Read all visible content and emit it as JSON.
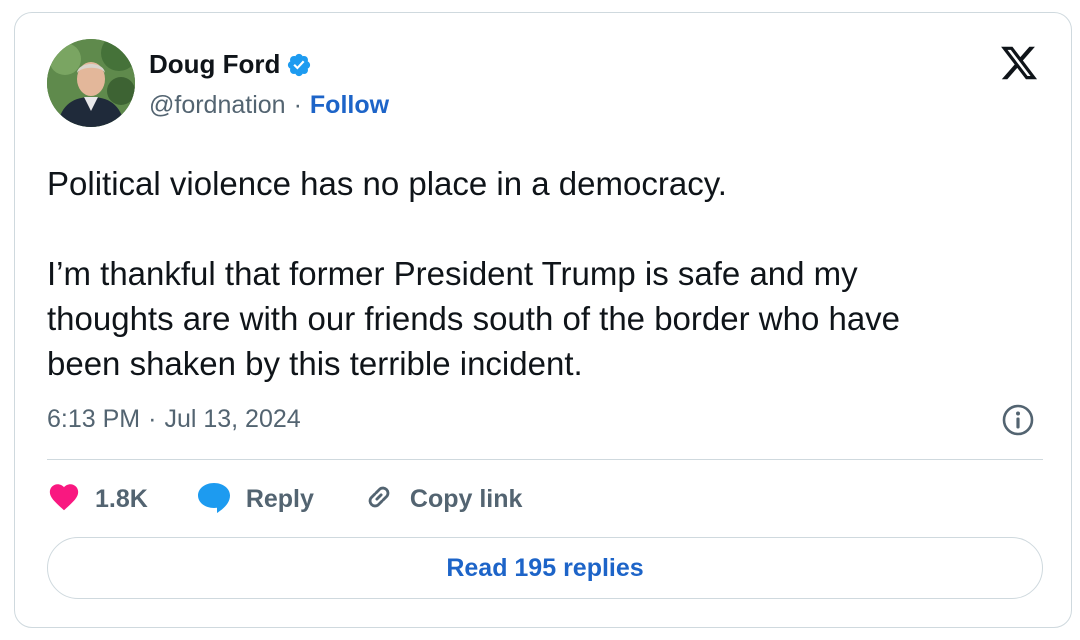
{
  "author": {
    "name": "Doug Ford",
    "handle": "@fordnation",
    "separator": "·",
    "follow_label": "Follow",
    "verified_icon": "verified-badge-icon",
    "verified_color": "#1d9bf0"
  },
  "platform_icon": "x-logo-icon",
  "tweet": {
    "paragraph_1": "Political violence has no place in a democracy.",
    "paragraph_2_line_1": "I’m thankful that former President Trump is safe and my",
    "paragraph_2_line_2": "thoughts are with our friends south of the border who have",
    "paragraph_2_line_3": "been shaken by this terrible incident."
  },
  "timestamp": {
    "time": "6:13 PM",
    "separator": "·",
    "date": "Jul 13, 2024"
  },
  "actions": {
    "like_count": "1.8K",
    "like_icon": "heart-icon",
    "like_color": "#f91880",
    "reply_label": "Reply",
    "reply_icon": "speech-bubble-icon",
    "reply_color": "#1d9bf0",
    "copy_label": "Copy link",
    "copy_icon": "link-icon"
  },
  "read_replies_label": "Read 195 replies",
  "colors": {
    "link_blue": "#1d64c8",
    "muted_text": "#536471",
    "border": "#cfd9de"
  }
}
